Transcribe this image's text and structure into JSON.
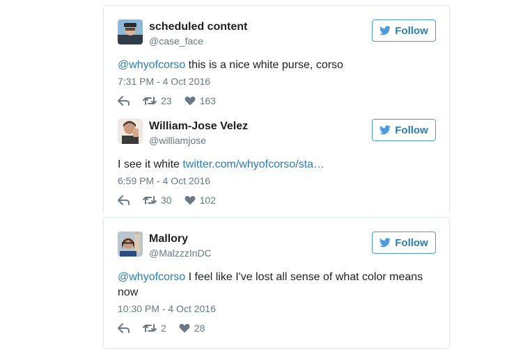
{
  "colors": {
    "link": "#2b7bb9",
    "muted": "#697882",
    "border": "#e1e8ed",
    "follow_border": "#4a9be0"
  },
  "tweets": [
    {
      "name": "scheduled content",
      "handle": "@case_face",
      "follow_label": "Follow",
      "text_link": "@whyofcorso",
      "text_rest": " this is a nice white purse, corso",
      "timestamp": "7:31 PM - 4 Oct 2016",
      "retweets": "23",
      "likes": "163",
      "avatar_icon": "avatar-photo"
    },
    {
      "name": "William-Jose Velez",
      "handle": "@williamjose",
      "follow_label": "Follow",
      "text_prefix": "I see it white ",
      "text_link": "twitter.com/whyofcorso/sta…",
      "timestamp": "6:59 PM - 4 Oct 2016",
      "retweets": "30",
      "likes": "102",
      "avatar_icon": "avatar-photo"
    },
    {
      "name": "Mallory",
      "handle": "@MalzzzInDC",
      "follow_label": "Follow",
      "text_link": "@whyofcorso",
      "text_rest": " I feel like I've lost all sense of what color means now",
      "timestamp": "10:30 PM - 4 Oct 2016",
      "retweets": "2",
      "likes": "28",
      "avatar_icon": "avatar-photo"
    }
  ]
}
